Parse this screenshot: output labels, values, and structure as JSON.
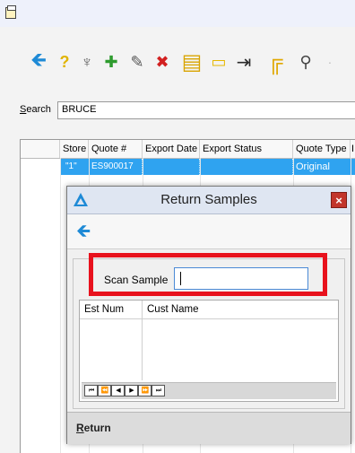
{
  "window": {
    "app_icon": "clipboard-icon"
  },
  "toolbar": {
    "buttons": [
      {
        "icon": "back-arrow-icon",
        "glyph": "🡸",
        "color": "#1e8ad6"
      },
      {
        "icon": "help-icon",
        "glyph": "?",
        "color": "#e0b400"
      },
      {
        "icon": "tools-icon",
        "glyph": "♆",
        "color": "#666666"
      },
      {
        "icon": "add-icon",
        "glyph": "✚",
        "color": "#2e9b2e"
      },
      {
        "icon": "edit-icon",
        "glyph": "✎",
        "color": "#555555"
      },
      {
        "icon": "delete-icon",
        "glyph": "✖",
        "color": "#d22020"
      },
      {
        "icon": "report-icon",
        "glyph": "▤",
        "color": "#d9a400"
      },
      {
        "icon": "note-icon",
        "glyph": "▭",
        "color": "#e6b800"
      },
      {
        "icon": "export-icon",
        "glyph": "⇥",
        "color": "#2a2a2a"
      },
      {
        "icon": "pipeline-icon",
        "glyph": "╔",
        "color": "#e0a800"
      },
      {
        "icon": "link-icon",
        "glyph": "⚲",
        "color": "#444444"
      }
    ]
  },
  "search": {
    "label_mnemonic": "S",
    "label_rest": "earch",
    "value": "BRUCE"
  },
  "grid": {
    "columns": [
      "Store",
      "Quote #",
      "Export Date",
      "Export Status",
      "Quote Type",
      "I"
    ],
    "rows": [
      {
        "store": "\"1\"",
        "quote": "ES900017",
        "export_date": "",
        "export_status": "",
        "quote_type": "Original"
      }
    ]
  },
  "dialog": {
    "title": "Return Samples",
    "logo_color": "#1e8ad6",
    "close_label": "×",
    "scan_label": "Scan Sample",
    "scan_value": "",
    "subgrid_columns": [
      "Est Num",
      "Cust Name"
    ],
    "nav_buttons": [
      "⏮",
      "⏪",
      "◀",
      "▶",
      "⏩",
      "⏭"
    ],
    "return_mnemonic": "R",
    "return_rest": "eturn"
  },
  "highlight_color": "#e8121d"
}
